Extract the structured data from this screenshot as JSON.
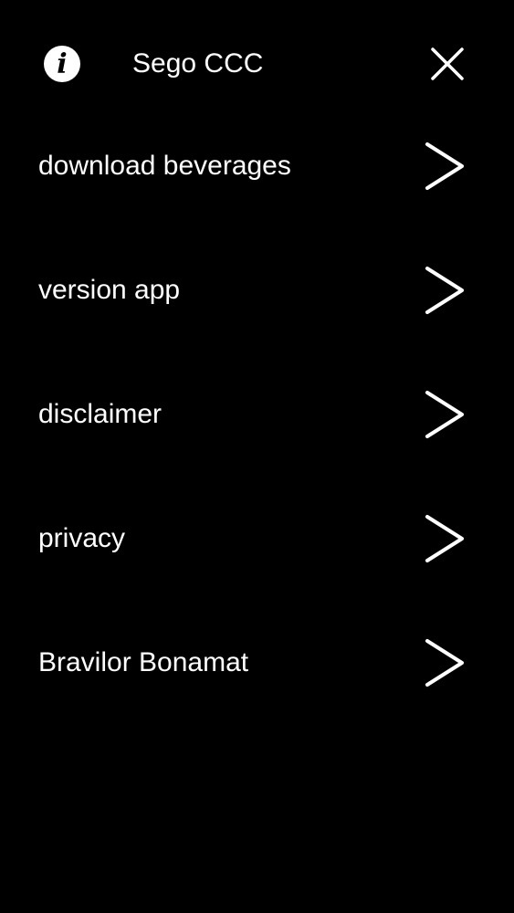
{
  "header": {
    "title": "Sego CCC",
    "info_icon": "info-icon",
    "close_icon": "close-icon"
  },
  "menu": {
    "items": [
      {
        "label": "download beverages",
        "icon": "chevron-right-icon"
      },
      {
        "label": "version app",
        "icon": "chevron-right-icon"
      },
      {
        "label": "disclaimer",
        "icon": "chevron-right-icon"
      },
      {
        "label": "privacy",
        "icon": "chevron-right-icon"
      },
      {
        "label": "Bravilor Bonamat",
        "icon": "chevron-right-icon"
      }
    ]
  },
  "colors": {
    "background": "#000000",
    "foreground": "#ffffff"
  }
}
